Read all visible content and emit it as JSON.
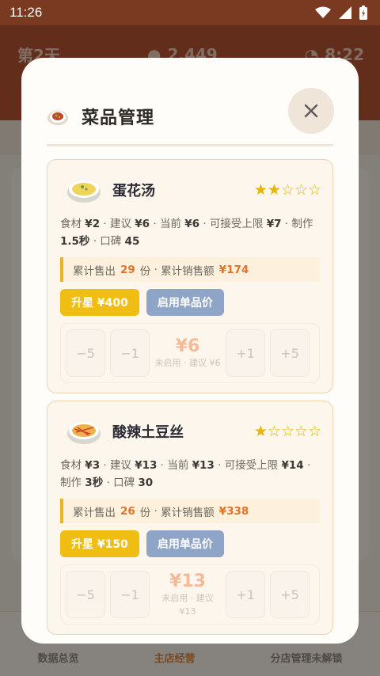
{
  "status_bar": {
    "time": "11:26"
  },
  "background": {
    "day": "第2天",
    "coins": "2,449",
    "clock": "8:22",
    "nav": [
      "数据总览",
      "主店经营",
      "分店管理未解锁"
    ]
  },
  "modal": {
    "title": "菜品管理",
    "dishes": [
      {
        "name": "蛋花汤",
        "stars": "★★☆☆☆",
        "info": [
          [
            "食材",
            "¥2"
          ],
          [
            "建议",
            "¥6"
          ],
          [
            "当前",
            "¥6"
          ],
          [
            "可接受上限",
            "¥7"
          ],
          [
            "制作",
            "1.5秒"
          ],
          [
            "口碑",
            "45"
          ]
        ],
        "sold_label": "累计售出",
        "sold_count": "29",
        "sold_unit": "份",
        "revenue_label": "累计销售额",
        "revenue": "¥174",
        "upgrade_label": "升星 ¥400",
        "price_toggle_label": "启用单品价",
        "adjust": {
          "minus5": "−5",
          "minus1": "−1",
          "price": "¥6",
          "note": "未启用 · 建议 ¥6",
          "plus1": "+1",
          "plus5": "+5"
        }
      },
      {
        "name": "酸辣土豆丝",
        "stars": "★☆☆☆☆",
        "info": [
          [
            "食材",
            "¥3"
          ],
          [
            "建议",
            "¥13"
          ],
          [
            "当前",
            "¥13"
          ],
          [
            "可接受上限",
            "¥14"
          ],
          [
            "制作",
            "3秒"
          ],
          [
            "口碑",
            "30"
          ]
        ],
        "sold_label": "累计售出",
        "sold_count": "26",
        "sold_unit": "份",
        "revenue_label": "累计销售额",
        "revenue": "¥338",
        "upgrade_label": "升星 ¥150",
        "price_toggle_label": "启用单品价",
        "adjust": {
          "minus5": "−5",
          "minus1": "−1",
          "price": "¥13",
          "note": "未启用 · 建议 ¥13",
          "plus1": "+1",
          "plus5": "+5"
        }
      }
    ]
  },
  "colors": {
    "accent": "#f0bd13",
    "price_button": "#8ea5c7",
    "highlight": "#e2742a",
    "header": "#b25332"
  }
}
